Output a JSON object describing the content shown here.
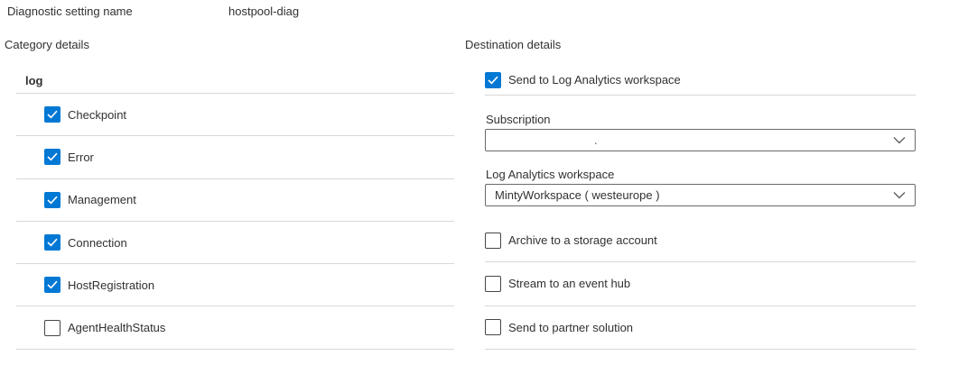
{
  "header": {
    "name_label": "Diagnostic setting name",
    "name_value": "hostpool-diag"
  },
  "category": {
    "heading": "Category details",
    "group_label": "log",
    "items": [
      {
        "label": "Checkpoint",
        "checked": true
      },
      {
        "label": "Error",
        "checked": true
      },
      {
        "label": "Management",
        "checked": true
      },
      {
        "label": "Connection",
        "checked": true
      },
      {
        "label": "HostRegistration",
        "checked": true
      },
      {
        "label": "AgentHealthStatus",
        "checked": false
      }
    ]
  },
  "destination": {
    "heading": "Destination details",
    "log_analytics": {
      "label": "Send to Log Analytics workspace",
      "checked": true
    },
    "subscription": {
      "label": "Subscription",
      "value": "."
    },
    "workspace": {
      "label": "Log Analytics workspace",
      "value": "MintyWorkspace ( westeurope )"
    },
    "options": [
      {
        "label": "Archive to a storage account",
        "checked": false
      },
      {
        "label": "Stream to an event hub",
        "checked": false
      },
      {
        "label": "Send to partner solution",
        "checked": false
      }
    ]
  },
  "icons": {
    "checkbox_check": "check-mark",
    "dropdown_chevron": "chevron-down"
  },
  "colors": {
    "accent": "#0078d4",
    "text": "#323130",
    "divider": "#d8d8d8",
    "checkbox_border": "#484644",
    "dropdown_border": "#6b6b6b"
  }
}
